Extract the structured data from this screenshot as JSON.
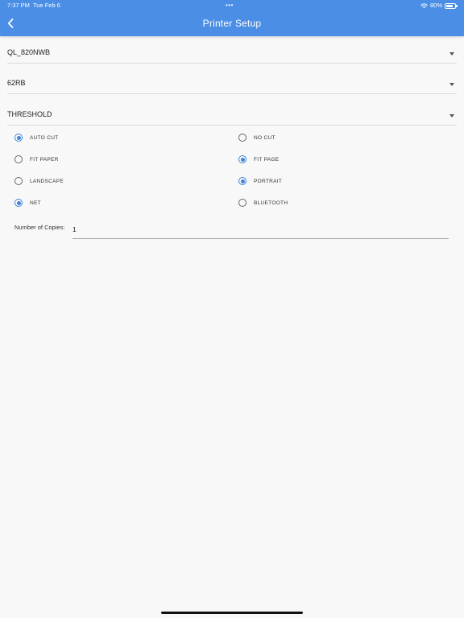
{
  "status_bar": {
    "time": "7:37 PM",
    "date": "Tue Feb 6",
    "dots": "•••",
    "battery": "80%",
    "battery_level": 0.8
  },
  "header": {
    "title": "Printer Setup",
    "back_icon": "chevron-left-icon"
  },
  "selects": {
    "printer_model": "QL_820NWB",
    "label_size": "62RB",
    "print_mode": "THRESHOLD"
  },
  "options": {
    "auto_cut": {
      "label": "AUTO CUT",
      "selected": true
    },
    "no_cut": {
      "label": "NO CUT",
      "selected": false
    },
    "fit_paper": {
      "label": "FIT PAPER",
      "selected": false
    },
    "fit_page": {
      "label": "FIT PAGE",
      "selected": true
    },
    "landscape": {
      "label": "LANDSCAPE",
      "selected": false
    },
    "portrait": {
      "label": "PORTRAIT",
      "selected": true
    },
    "net": {
      "label": "NET",
      "selected": true
    },
    "bluetooth": {
      "label": "BLUETOOTH",
      "selected": false
    }
  },
  "copies": {
    "label": "Number of Copies:",
    "value": "1"
  },
  "colors": {
    "app_bar": "#4a8ee6",
    "accent": "#3d84db",
    "background": "#f8f8f8"
  }
}
